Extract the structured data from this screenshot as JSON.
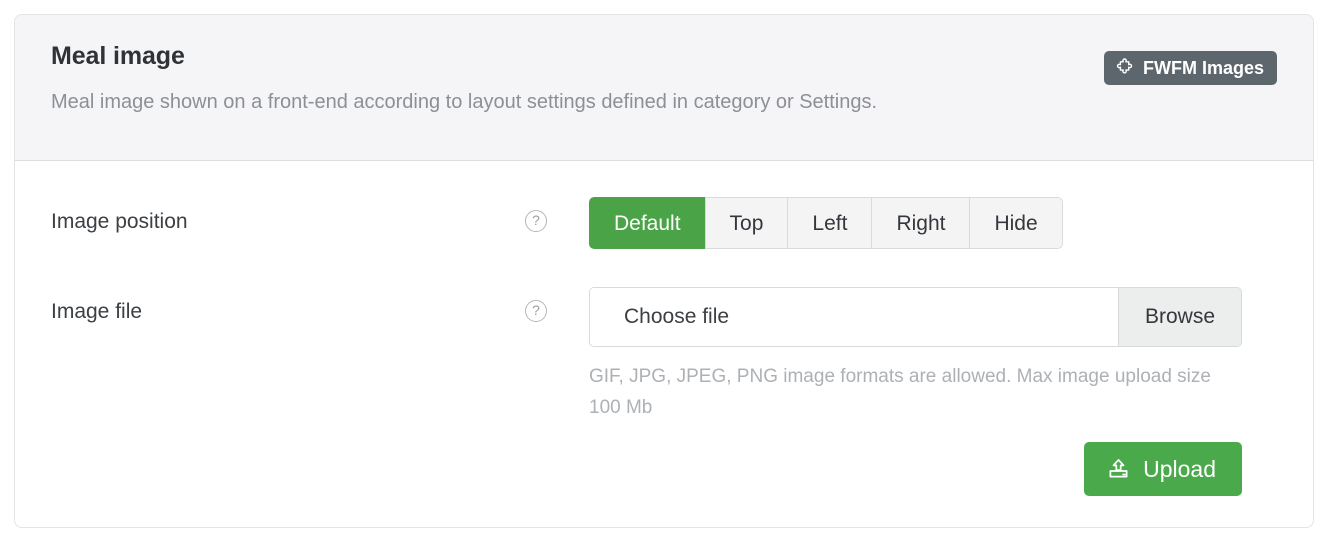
{
  "card": {
    "title": "Meal image",
    "description": "Meal image shown on a front-end according to layout settings defined in category or Settings.",
    "badge": {
      "label": "FWFM Images",
      "icon": "puzzle-icon",
      "background": "#5d666d",
      "text_color": "#ffffff"
    },
    "header_background": "#f5f5f7",
    "border_color": "#e3e4e6"
  },
  "rows": {
    "image_position": {
      "label": "Image position",
      "help_icon": "question-mark-icon",
      "help_glyph": "?",
      "options": [
        {
          "label": "Default",
          "active": true
        },
        {
          "label": "Top",
          "active": false
        },
        {
          "label": "Left",
          "active": false
        },
        {
          "label": "Right",
          "active": false
        },
        {
          "label": "Hide",
          "active": false
        }
      ],
      "selected": "Default",
      "active_color": "#4aa347",
      "inactive_color": "#f4f4f5"
    },
    "image_file": {
      "label": "Image file",
      "help_icon": "question-mark-icon",
      "help_glyph": "?",
      "file_value": "Choose file",
      "file_placeholder": "Choose file",
      "browse_label": "Browse",
      "hint": "GIF, JPG, JPEG, PNG image formats are allowed. Max image upload size 100 Mb",
      "upload_label": "Upload",
      "upload_icon": "upload-icon",
      "upload_color": "#4aa94a"
    }
  }
}
